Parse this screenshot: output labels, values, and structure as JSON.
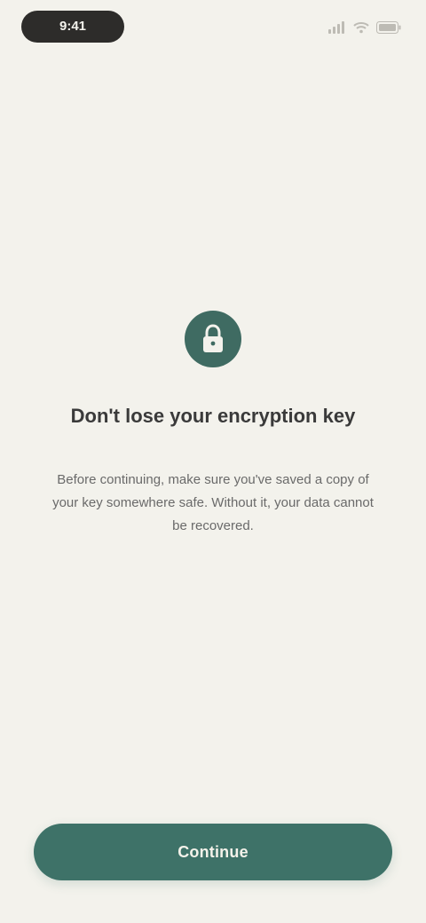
{
  "status_bar": {
    "time": "9:41",
    "icons": [
      "signal-icon",
      "wifi-icon",
      "battery-icon"
    ]
  },
  "main": {
    "icon": "lock-icon",
    "title": "Don't lose your encryption key",
    "description": "Before continuing, make sure you've saved a copy of your key somewhere safe. Without it, your data cannot be recovered."
  },
  "action": {
    "continue_label": "Continue"
  },
  "colors": {
    "background": "#f3f2ec",
    "accent": "#3e7268",
    "status_pill": "#2d2c2a"
  }
}
